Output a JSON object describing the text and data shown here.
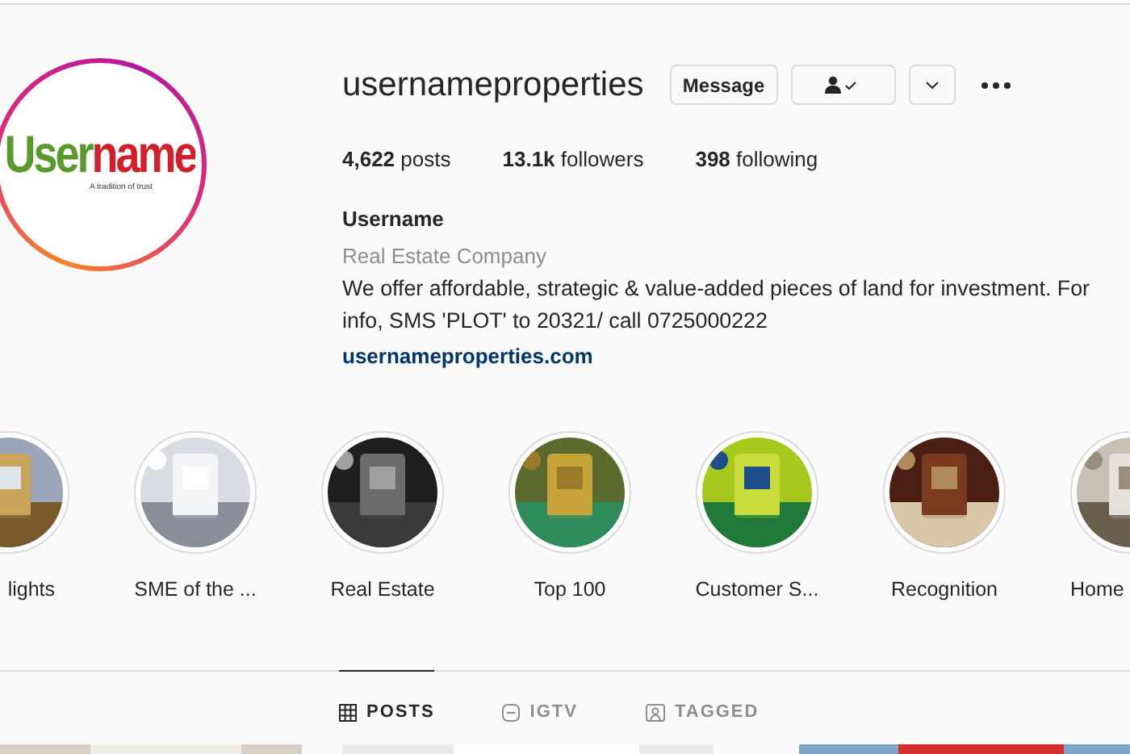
{
  "profile": {
    "logo": {
      "wordmark": "Username",
      "tagline": "A tradition of trust"
    },
    "username": "usernameproperties",
    "buttons": {
      "message": "Message"
    },
    "following": true
  },
  "stats": [
    {
      "count": "4,622",
      "label": "posts"
    },
    {
      "count": "13.1k",
      "label": "followers"
    },
    {
      "count": "398",
      "label": "following"
    }
  ],
  "bio": {
    "name": "Username",
    "category": "Real Estate Company",
    "text": "We offer affordable, strategic & value-added pieces of land for investment. For info, SMS 'PLOT' to 20321/ call 0725000222",
    "link": "usernameproperties.com"
  },
  "highlights": [
    {
      "label": "lights"
    },
    {
      "label": "SME of the ..."
    },
    {
      "label": "Real Estate"
    },
    {
      "label": "Top 100"
    },
    {
      "label": "Customer S..."
    },
    {
      "label": "Recognition"
    },
    {
      "label": "Home"
    }
  ],
  "tabs": [
    {
      "label": "POSTS",
      "kind": "grid",
      "selected": true
    },
    {
      "label": "IGTV",
      "kind": "tv",
      "selected": false
    },
    {
      "label": "TAGGED",
      "kind": "tag",
      "selected": false
    }
  ]
}
